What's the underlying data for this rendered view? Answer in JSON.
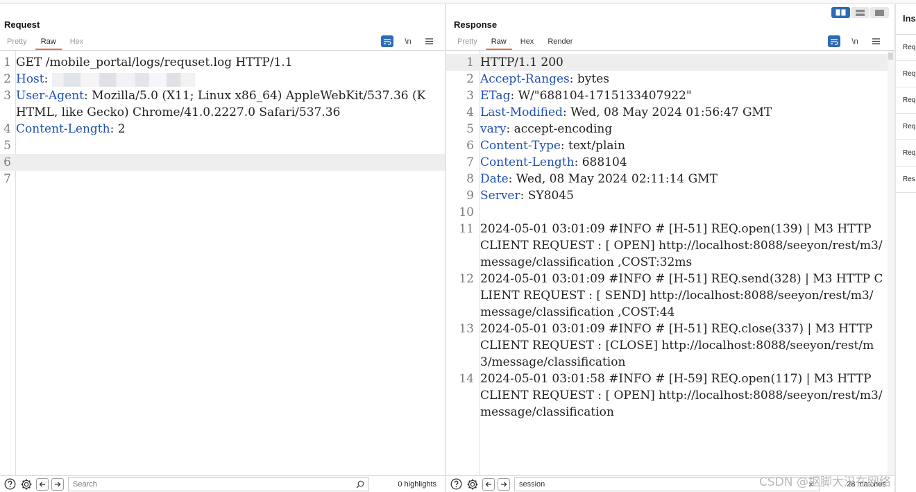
{
  "request": {
    "title": "Request",
    "tabs": [
      {
        "label": "Pretty",
        "active": false
      },
      {
        "label": "Raw",
        "active": true
      },
      {
        "label": "Hex",
        "active": false
      }
    ],
    "newline_toggle": "\\n",
    "lines": [
      {
        "n": "1",
        "key": "",
        "text": "GET /mobile_portal/logs/requset.log HTTP/1.1"
      },
      {
        "n": "2",
        "key": "Host",
        "text": ":"
      },
      {
        "n": "3",
        "key": "User-Agent",
        "text": ": Mozilla/5.0 (X11; Linux x86_64) AppleWebKit/537.36 (KHTML, like Gecko) Chrome/41.0.2227.0 Safari/537.36"
      },
      {
        "n": "4",
        "key": "Content-Length",
        "text": ": 2"
      },
      {
        "n": "5",
        "key": "",
        "text": ""
      },
      {
        "n": "6",
        "key": "",
        "text": ""
      },
      {
        "n": "7",
        "key": "",
        "text": ""
      }
    ],
    "search": {
      "placeholder": "Search",
      "value": ""
    },
    "highlights": "0 highlights"
  },
  "response": {
    "title": "Response",
    "tabs": [
      {
        "label": "Pretty",
        "active": false
      },
      {
        "label": "Raw",
        "active": true
      },
      {
        "label": "Hex",
        "active": false
      },
      {
        "label": "Render",
        "active": false
      }
    ],
    "newline_toggle": "\\n",
    "lines": [
      {
        "n": "1",
        "key": "",
        "text": "HTTP/1.1 200"
      },
      {
        "n": "2",
        "key": "Accept-Ranges",
        "text": ": bytes"
      },
      {
        "n": "3",
        "key": "ETag",
        "text": ": W/\"688104-1715133407922\""
      },
      {
        "n": "4",
        "key": "Last-Modified",
        "text": ": Wed, 08 May 2024 01:56:47 GMT"
      },
      {
        "n": "5",
        "key": "vary",
        "text": ": accept-encoding"
      },
      {
        "n": "6",
        "key": "Content-Type",
        "text": ": text/plain"
      },
      {
        "n": "7",
        "key": "Content-Length",
        "text": ": 688104"
      },
      {
        "n": "8",
        "key": "Date",
        "text": ": Wed, 08 May 2024 02:11:14 GMT"
      },
      {
        "n": "9",
        "key": "Server",
        "text": ": SY8045"
      },
      {
        "n": "10",
        "key": "",
        "text": ""
      },
      {
        "n": "11",
        "key": "",
        "text": "2024-05-01 03:01:09 #INFO # [H-51] REQ.open(139) | M3 HTTP CLIENT REQUEST : [ OPEN] http://localhost:8088/seeyon/rest/m3/message/classification ,COST:32ms"
      },
      {
        "n": "12",
        "key": "",
        "text": "2024-05-01 03:01:09 #INFO # [H-51] REQ.send(328) | M3 HTTP CLIENT REQUEST : [ SEND] http://localhost:8088/seeyon/rest/m3/message/classification ,COST:44"
      },
      {
        "n": "13",
        "key": "",
        "text": "2024-05-01 03:01:09 #INFO # [H-51] REQ.close(337) | M3 HTTP CLIENT REQUEST : [CLOSE] http://localhost:8088/seeyon/rest/m3/message/classification"
      },
      {
        "n": "14",
        "key": "",
        "text": "2024-05-01 03:01:58 #INFO # [H-59] REQ.open(117) | M3 HTTP CLIENT REQUEST : [ OPEN] http://localhost:8088/seeyon/rest/m3/message/classification"
      }
    ],
    "search": {
      "placeholder": "Search",
      "value": "session"
    },
    "matches": "28 matches"
  },
  "inspector": {
    "title": "Ins",
    "rows": [
      "Req",
      "Req",
      "Req",
      "Req",
      "Req",
      "Res"
    ]
  },
  "watermark": "CSDN @抠脚大汉在网络",
  "icons": {
    "help": "question-icon",
    "settings": "gear-icon",
    "back": "arrow-left-icon",
    "forward": "arrow-right-icon",
    "search": "magnifier-icon",
    "clear": "close-icon"
  },
  "colors": {
    "header_key": "#1f4fb4",
    "tab_underline": "#ef6b3b",
    "accent_button": "#2e6bb5"
  }
}
